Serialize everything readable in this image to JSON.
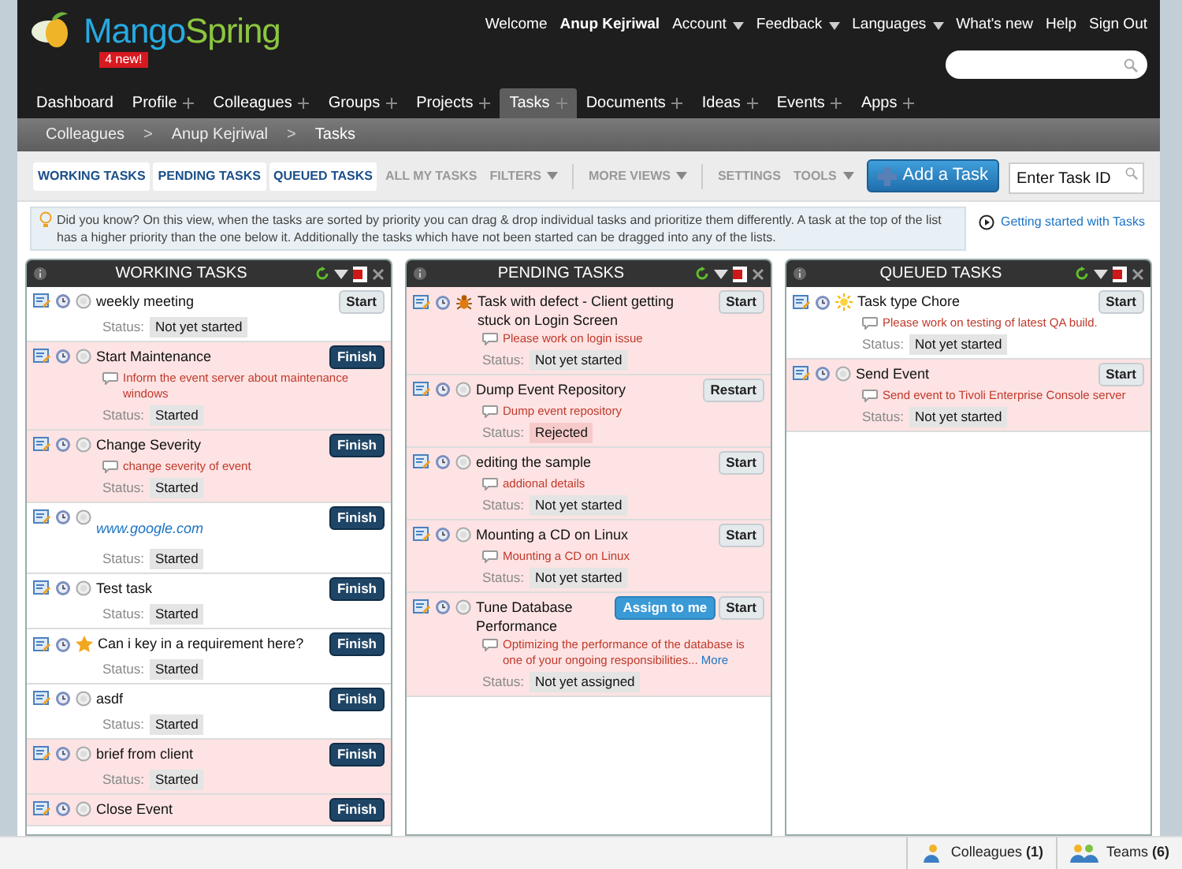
{
  "logo": {
    "name_a": "Mango",
    "name_b": "Spring",
    "badge": "4 new!"
  },
  "top_links": [
    {
      "label": "Welcome",
      "bold": false,
      "menu": false
    },
    {
      "label": "Anup Kejriwal",
      "bold": true,
      "menu": false
    },
    {
      "label": "Account",
      "bold": false,
      "menu": true
    },
    {
      "label": "Feedback",
      "bold": false,
      "menu": true
    },
    {
      "label": "Languages",
      "bold": false,
      "menu": true
    },
    {
      "label": "What's new",
      "bold": false,
      "menu": false
    },
    {
      "label": "Help",
      "bold": false,
      "menu": false
    },
    {
      "label": "Sign Out",
      "bold": false,
      "menu": false
    }
  ],
  "nav": [
    {
      "label": "Dashboard",
      "expandable": false,
      "selected": false
    },
    {
      "label": "Profile",
      "expandable": true,
      "selected": false
    },
    {
      "label": "Colleagues",
      "expandable": true,
      "selected": false
    },
    {
      "label": "Groups",
      "expandable": true,
      "selected": false
    },
    {
      "label": "Projects",
      "expandable": true,
      "selected": false
    },
    {
      "label": "Tasks",
      "expandable": true,
      "selected": true
    },
    {
      "label": "Documents",
      "expandable": true,
      "selected": false
    },
    {
      "label": "Ideas",
      "expandable": true,
      "selected": false
    },
    {
      "label": "Events",
      "expandable": true,
      "selected": false
    },
    {
      "label": "Apps",
      "expandable": true,
      "selected": false
    }
  ],
  "breadcrumb": [
    {
      "label": "Colleagues",
      "kind": "link"
    },
    {
      "label": ">",
      "kind": "sep"
    },
    {
      "label": "Anup Kejriwal",
      "kind": "link"
    },
    {
      "label": ">",
      "kind": "sep"
    },
    {
      "label": "Tasks",
      "kind": "current"
    }
  ],
  "views": [
    {
      "label": "WORKING TASKS",
      "selected": true,
      "menu": false,
      "divider_after": false
    },
    {
      "label": "PENDING TASKS",
      "selected": true,
      "menu": false,
      "divider_after": false
    },
    {
      "label": "QUEUED TASKS",
      "selected": true,
      "menu": false,
      "divider_after": false
    },
    {
      "label": "ALL MY TASKS",
      "selected": false,
      "menu": false,
      "divider_after": false
    },
    {
      "label": "FILTERS",
      "selected": false,
      "menu": true,
      "divider_after": true
    },
    {
      "label": "MORE VIEWS",
      "selected": false,
      "menu": true,
      "divider_after": true
    },
    {
      "label": "SETTINGS",
      "selected": false,
      "menu": false,
      "divider_after": false
    },
    {
      "label": "TOOLS",
      "selected": false,
      "menu": true,
      "divider_after": false
    }
  ],
  "add_button": "Add a Task",
  "task_id": {
    "placeholder": "Enter Task ID"
  },
  "tip": {
    "text": "Did you know? On this view, when the tasks are sorted by priority you can drag & drop individual tasks and prioritize them differently. A task at the top of the list has a higher priority than the one below it. Additionally the tasks which have not been started can be dragged into any of the lists.",
    "link": "Getting started with Tasks"
  },
  "columns": [
    {
      "title": "WORKING TASKS",
      "tasks": [
        {
          "title": "weekly meeting",
          "link": false,
          "kind": "circle",
          "highlighted": false,
          "status_label": "Status:",
          "status": "Not yet started",
          "status_alert": false,
          "buttons": [
            {
              "label": "Start",
              "kind": "start"
            }
          ]
        },
        {
          "title": "Start Maintenance",
          "link": false,
          "kind": "circle",
          "highlighted": true,
          "description": "Inform the event server about maintenance windows",
          "status_label": "Status:",
          "status": "Started",
          "status_alert": false,
          "buttons": [
            {
              "label": "Finish",
              "kind": "finish"
            }
          ]
        },
        {
          "title": "Change Severity",
          "link": false,
          "kind": "circle",
          "highlighted": true,
          "description": "change severity of event",
          "status_label": "Status:",
          "status": "Started",
          "status_alert": false,
          "buttons": [
            {
              "label": "Finish",
              "kind": "finish"
            }
          ]
        },
        {
          "title": "www.google.com",
          "link": true,
          "kind": "circle",
          "highlighted": false,
          "status_label": "Status:",
          "status": "Started",
          "status_alert": false,
          "buttons": [
            {
              "label": "Finish",
              "kind": "finish"
            }
          ]
        },
        {
          "title": "Test task",
          "link": false,
          "kind": "circle",
          "highlighted": false,
          "status_label": "Status:",
          "status": "Started",
          "status_alert": false,
          "buttons": [
            {
              "label": "Finish",
              "kind": "finish"
            }
          ]
        },
        {
          "title": "Can i key in a requirement here?",
          "link": false,
          "kind": "star",
          "highlighted": false,
          "status_label": "Status:",
          "status": "Started",
          "status_alert": false,
          "buttons": [
            {
              "label": "Finish",
              "kind": "finish"
            }
          ]
        },
        {
          "title": "asdf",
          "link": false,
          "kind": "circle",
          "highlighted": false,
          "status_label": "Status:",
          "status": "Started",
          "status_alert": false,
          "buttons": [
            {
              "label": "Finish",
              "kind": "finish"
            }
          ]
        },
        {
          "title": "brief from client",
          "link": false,
          "kind": "circle",
          "highlighted": true,
          "status_label": "Status:",
          "status": "Started",
          "status_alert": false,
          "buttons": [
            {
              "label": "Finish",
              "kind": "finish"
            }
          ]
        },
        {
          "title": "Close Event",
          "link": false,
          "kind": "circle",
          "highlighted": true,
          "buttons": [
            {
              "label": "Finish",
              "kind": "finish"
            }
          ]
        }
      ]
    },
    {
      "title": "PENDING TASKS",
      "tasks": [
        {
          "title": "Task with defect - Client getting stuck on Login Screen",
          "link": false,
          "kind": "bug",
          "highlighted": true,
          "description": "Please work on login issue",
          "status_label": "Status:",
          "status": "Not yet started",
          "status_alert": false,
          "buttons": [
            {
              "label": "Start",
              "kind": "start"
            }
          ]
        },
        {
          "title": "Dump Event Repository",
          "link": false,
          "kind": "circle",
          "highlighted": true,
          "description": "Dump event repository",
          "status_label": "Status:",
          "status": "Rejected",
          "status_alert": true,
          "buttons": [
            {
              "label": "Restart",
              "kind": "start"
            }
          ]
        },
        {
          "title": "editing the sample",
          "link": false,
          "kind": "circle",
          "highlighted": true,
          "description": "addional details",
          "status_label": "Status:",
          "status": "Not yet started",
          "status_alert": false,
          "buttons": [
            {
              "label": "Start",
              "kind": "start"
            }
          ]
        },
        {
          "title": "Mounting a CD on Linux",
          "link": false,
          "kind": "circle",
          "highlighted": true,
          "description": "Mounting a CD on Linux",
          "status_label": "Status:",
          "status": "Not yet started",
          "status_alert": false,
          "buttons": [
            {
              "label": "Start",
              "kind": "start"
            }
          ]
        },
        {
          "title": "Tune Database Performance",
          "link": false,
          "kind": "circle",
          "highlighted": true,
          "description": "Optimizing the performance of the database is one of your ongoing responsibilities...",
          "more": "More",
          "status_label": "Status:",
          "status": "Not yet assigned",
          "status_alert": false,
          "buttons": [
            {
              "label": "Assign to me",
              "kind": "assign"
            },
            {
              "label": "Start",
              "kind": "start"
            }
          ]
        }
      ]
    },
    {
      "title": "QUEUED TASKS",
      "tasks": [
        {
          "title": "Task type Chore",
          "link": false,
          "kind": "sun",
          "highlighted": false,
          "description": "Please work on testing of latest QA build.",
          "status_label": "Status:",
          "status": "Not yet started",
          "status_alert": false,
          "buttons": [
            {
              "label": "Start",
              "kind": "start"
            }
          ]
        },
        {
          "title": "Send Event",
          "link": false,
          "kind": "circle",
          "highlighted": true,
          "description": "Send event to Tivoli Enterprise Console server",
          "status_label": "Status:",
          "status": "Not yet started",
          "status_alert": false,
          "buttons": [
            {
              "label": "Start",
              "kind": "start"
            }
          ]
        }
      ]
    }
  ],
  "footer": [
    {
      "label": "Colleagues",
      "count": "(1)",
      "kind": "person"
    },
    {
      "label": "Teams",
      "count": "(6)",
      "kind": "group"
    }
  ]
}
